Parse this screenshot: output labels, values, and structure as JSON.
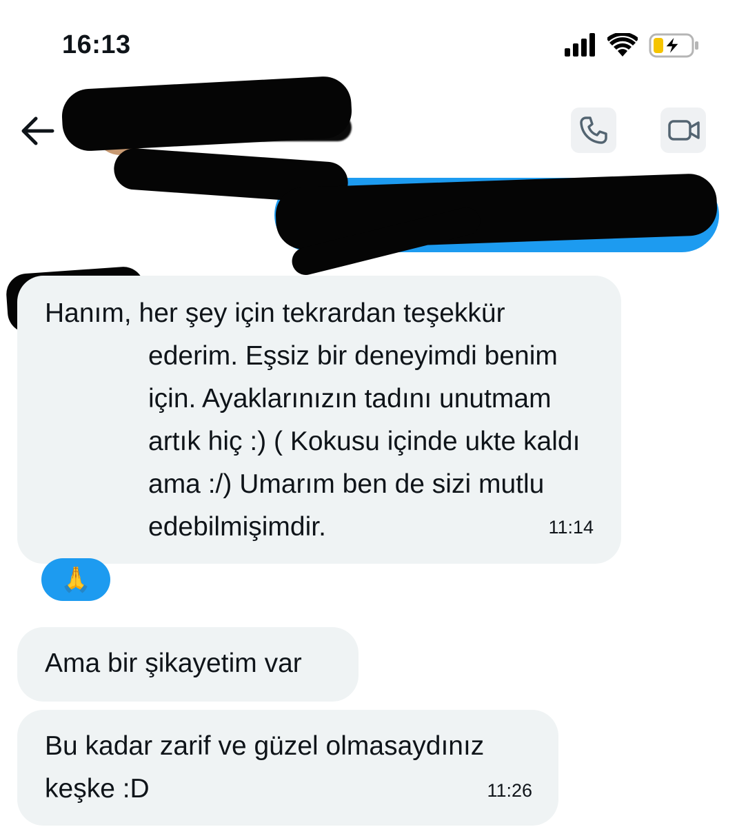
{
  "status_bar": {
    "time": "16:13",
    "icons": [
      "cellular-signal-icon",
      "wifi-icon",
      "battery-charging-icon"
    ]
  },
  "header": {
    "back_icon": "arrow-left-icon",
    "phone_icon": "phone-icon",
    "video_icon": "video-camera-icon"
  },
  "messages": [
    {
      "direction": "incoming",
      "text": "Hanım, her şey için tekrardan teşekkür ederim. Eşsiz bir deneyimdi benim için. Ayaklarınızın tadını unutmam artık hiç :) ( Kokusu içinde ukte kaldı ama :/) Umarım ben de sizi mutlu edebilmişimdir.",
      "time": "11:14",
      "reaction": "🙏"
    },
    {
      "direction": "incoming",
      "text": "Ama bir şikayetim var",
      "time": ""
    },
    {
      "direction": "incoming",
      "text": "Bu kadar zarif ve güzel olmasaydınız keşke :D",
      "time": "11:26"
    }
  ],
  "colors": {
    "accent": "#1d9bf0",
    "bubble_incoming": "#eff3f4",
    "text": "#0f1419"
  }
}
